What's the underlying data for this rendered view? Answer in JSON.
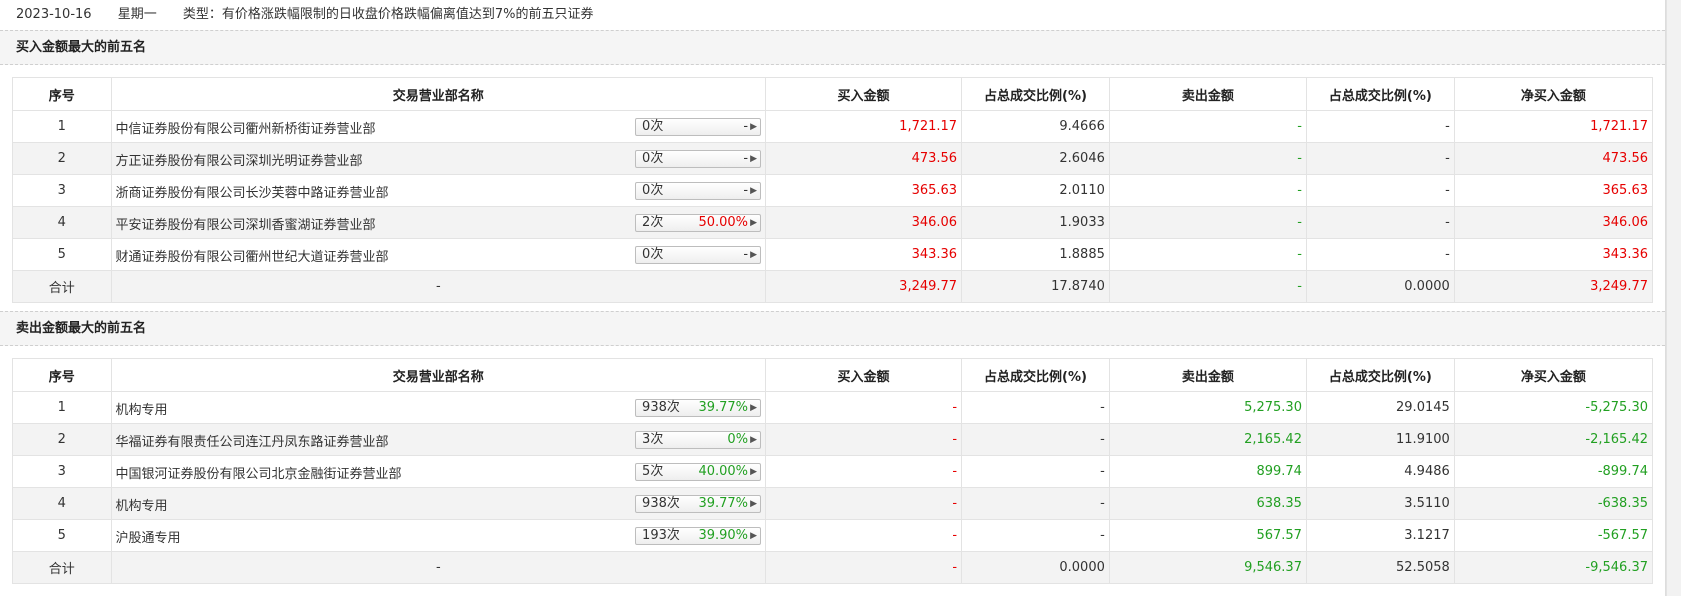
{
  "header": {
    "date": "2023-10-16",
    "weekday": "星期一",
    "type_text": "类型：有价格涨跌幅限制的日收盘价格跌幅偏离值达到7%的前五只证券"
  },
  "columns": [
    "序号",
    "交易营业部名称",
    "买入金额",
    "占总成交比例(%)",
    "卖出金额",
    "占总成交比例(%)",
    "净买入金额"
  ],
  "buy_section": {
    "title": "买入金额最大的前五名",
    "rows": [
      {
        "idx": "1",
        "name": "中信证券股份有限公司衢州新桥街证券营业部",
        "count": "0次",
        "rate": "-",
        "buy": "1,721.17",
        "buy_pct": "9.4666",
        "sell": "-",
        "sell_pct": "-",
        "net": "1,721.17"
      },
      {
        "idx": "2",
        "name": "方正证券股份有限公司深圳光明证券营业部",
        "count": "0次",
        "rate": "-",
        "buy": "473.56",
        "buy_pct": "2.6046",
        "sell": "-",
        "sell_pct": "-",
        "net": "473.56"
      },
      {
        "idx": "3",
        "name": "浙商证券股份有限公司长沙芙蓉中路证券营业部",
        "count": "0次",
        "rate": "-",
        "buy": "365.63",
        "buy_pct": "2.0110",
        "sell": "-",
        "sell_pct": "-",
        "net": "365.63"
      },
      {
        "idx": "4",
        "name": "平安证券股份有限公司深圳香蜜湖证券营业部",
        "count": "2次",
        "rate": "50.00%",
        "buy": "346.06",
        "buy_pct": "1.9033",
        "sell": "-",
        "sell_pct": "-",
        "net": "346.06"
      },
      {
        "idx": "5",
        "name": "财通证券股份有限公司衢州世纪大道证券营业部",
        "count": "0次",
        "rate": "-",
        "buy": "343.36",
        "buy_pct": "1.8885",
        "sell": "-",
        "sell_pct": "-",
        "net": "343.36"
      }
    ],
    "total": {
      "label": "合计",
      "name": "-",
      "buy": "3,249.77",
      "buy_pct": "17.8740",
      "sell": "-",
      "sell_pct": "0.0000",
      "net": "3,249.77"
    }
  },
  "sell_section": {
    "title": "卖出金额最大的前五名",
    "rows": [
      {
        "idx": "1",
        "name": "机构专用",
        "count": "938次",
        "rate": "39.77%",
        "buy": "-",
        "buy_pct": "-",
        "sell": "5,275.30",
        "sell_pct": "29.0145",
        "net": "-5,275.30"
      },
      {
        "idx": "2",
        "name": "华福证券有限责任公司连江丹凤东路证券营业部",
        "count": "3次",
        "rate": "0%",
        "buy": "-",
        "buy_pct": "-",
        "sell": "2,165.42",
        "sell_pct": "11.9100",
        "net": "-2,165.42"
      },
      {
        "idx": "3",
        "name": "中国银河证券股份有限公司北京金融街证券营业部",
        "count": "5次",
        "rate": "40.00%",
        "buy": "-",
        "buy_pct": "-",
        "sell": "899.74",
        "sell_pct": "4.9486",
        "net": "-899.74"
      },
      {
        "idx": "4",
        "name": "机构专用",
        "count": "938次",
        "rate": "39.77%",
        "buy": "-",
        "buy_pct": "-",
        "sell": "638.35",
        "sell_pct": "3.5110",
        "net": "-638.35"
      },
      {
        "idx": "5",
        "name": "沪股通专用",
        "count": "193次",
        "rate": "39.90%",
        "buy": "-",
        "buy_pct": "-",
        "sell": "567.57",
        "sell_pct": "3.1217",
        "net": "-567.57"
      }
    ],
    "total": {
      "label": "合计",
      "name": "-",
      "buy": "-",
      "buy_pct": "0.0000",
      "sell": "9,546.37",
      "sell_pct": "52.5058",
      "net": "-9,546.37"
    }
  },
  "icons": {
    "pill_arrow": "play-right-icon"
  },
  "colors": {
    "up": "#e60000",
    "down": "#22a022"
  }
}
